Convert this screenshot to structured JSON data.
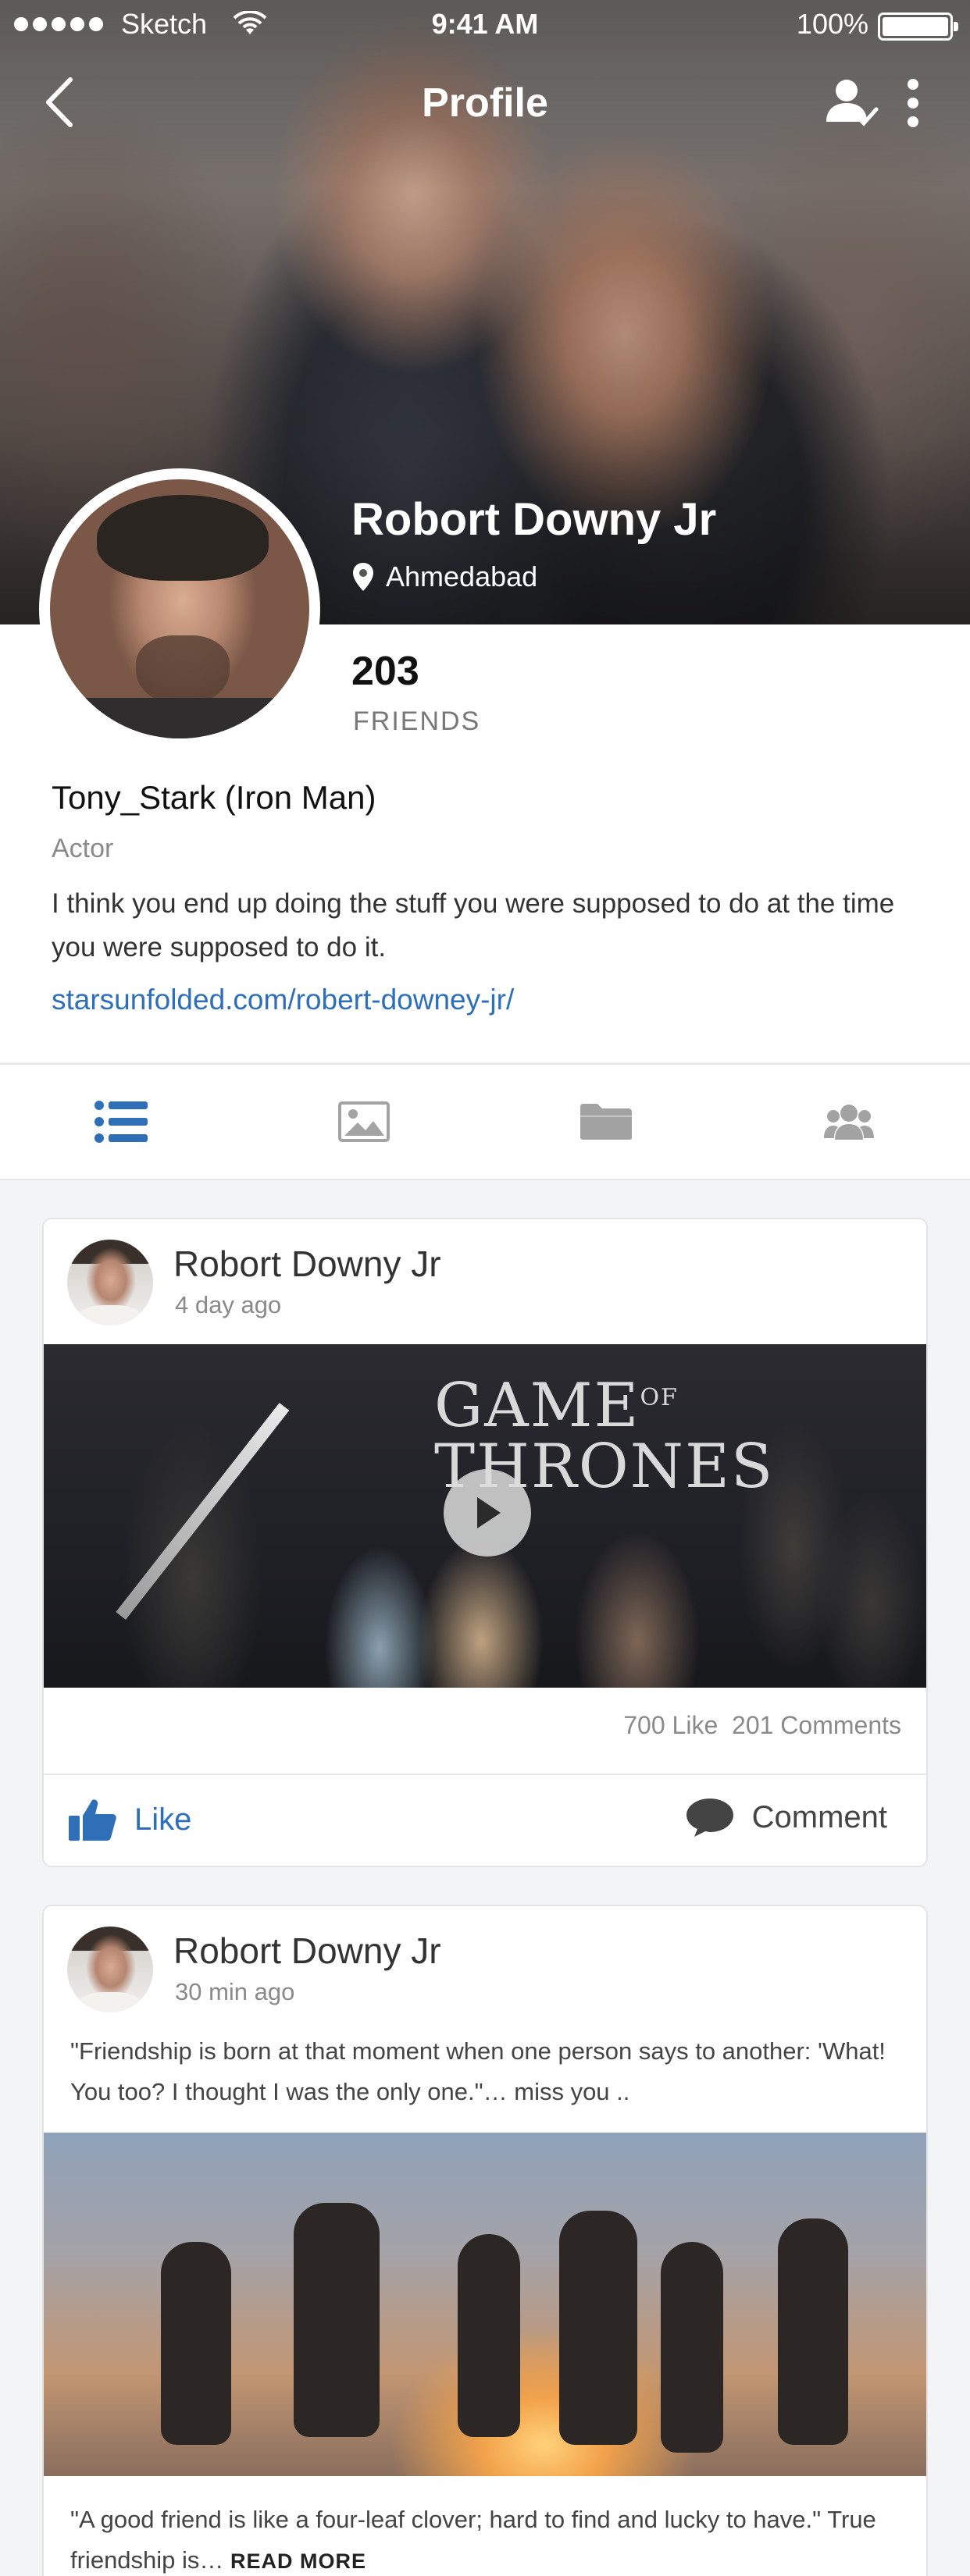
{
  "status_bar": {
    "carrier": "Sketch",
    "time": "9:41 AM",
    "battery": "100%"
  },
  "nav": {
    "title": "Profile"
  },
  "profile": {
    "name": "Robort Downy Jr",
    "location": "Ahmedabad",
    "friends_count": "203",
    "friends_label": "FRIENDS",
    "username": "Tony_Stark (Iron Man)",
    "role": "Actor",
    "bio": "I think you end up doing the stuff you were supposed to do at the time you were supposed to do it.",
    "website": "starsunfolded.com/robert-downey-jr/"
  },
  "tabs": [
    {
      "icon": "list-icon",
      "active": true
    },
    {
      "icon": "image-icon",
      "active": false
    },
    {
      "icon": "folder-icon",
      "active": false
    },
    {
      "icon": "group-icon",
      "active": false
    }
  ],
  "colors": {
    "accent": "#2e6fb7",
    "inactive_icon": "#a3a3a3"
  },
  "posts": [
    {
      "author": "Robort Downy Jr",
      "time": "4 day ago",
      "media_title": "GAME OF THRONES",
      "media_title_line1": "GAME",
      "media_title_of": "OF",
      "media_title_line2": "THRONES",
      "likes": "700 Like",
      "comments": "201 Comments",
      "like_label": "Like",
      "comment_label": "Comment"
    },
    {
      "author": "Robort Downy Jr",
      "time": "30 min ago",
      "text": "\"Friendship is born at that moment when one person says to another: 'What! You too? I thought I was the only one.\"… miss you ..",
      "caption": "\"A good friend is like a four-leaf clover; hard to find and lucky to have.\" True friendship is…",
      "read_more": "READ MORE"
    }
  ]
}
